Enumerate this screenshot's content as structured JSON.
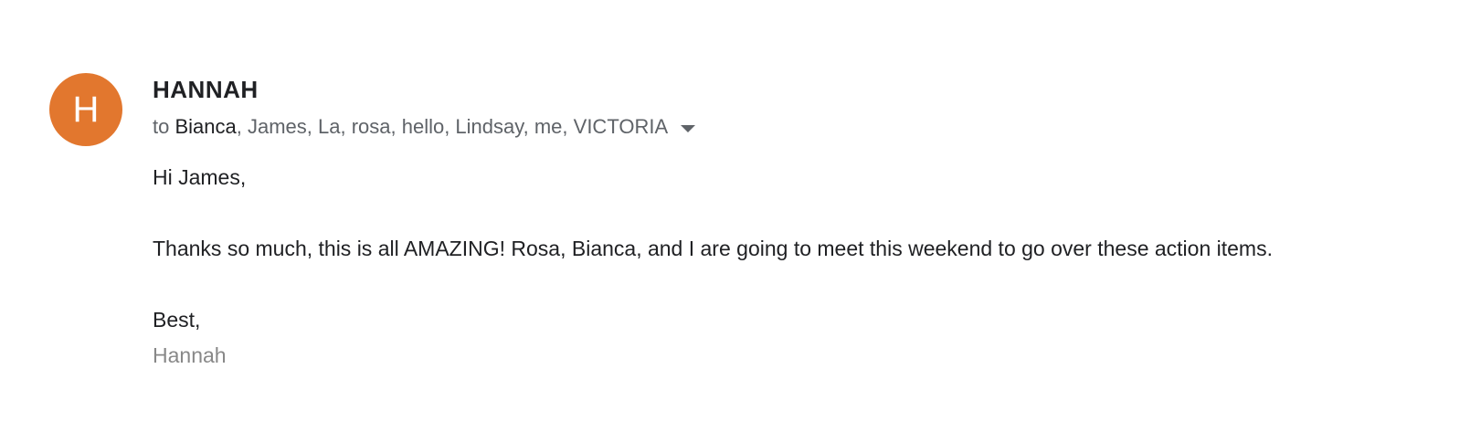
{
  "avatar": {
    "letter": "H",
    "color": "#e2772e"
  },
  "sender": {
    "name": "HANNAH"
  },
  "recipients": {
    "prefix": "to",
    "first": "Bianca",
    "rest": ", James, La, rosa, hello, Lindsay, me, VICTORIA",
    "expand_icon": "caret-down-icon"
  },
  "body": {
    "greeting": "Hi James,",
    "paragraph": "Thanks so much, this is all AMAZING! Rosa, Bianca, and I are going to meet this weekend to go over these action items.",
    "closing": "Best,",
    "signature": "Hannah"
  }
}
